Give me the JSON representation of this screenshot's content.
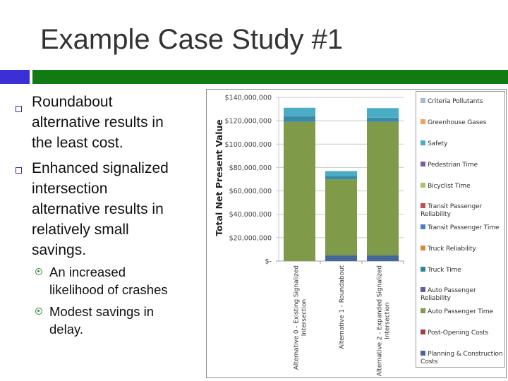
{
  "slide": {
    "title": "Example Case Study #1",
    "accent_colors": {
      "left_block": "#3b2fd6",
      "header_bar": "#127a12"
    },
    "bullets": [
      {
        "text_lines": [
          "Roundabout",
          "alternative results in",
          "the least cost."
        ]
      },
      {
        "text_lines": [
          "Enhanced signalized",
          "intersection",
          "alternative results in",
          "relatively small",
          "savings."
        ]
      }
    ],
    "sub_bullets": [
      {
        "text_lines": [
          "An increased",
          "likelihood of crashes"
        ]
      },
      {
        "text_lines": [
          "Modest savings in",
          "delay."
        ]
      }
    ]
  },
  "chart_data": {
    "type": "bar",
    "stacked": true,
    "title": "",
    "xlabel": "",
    "ylabel": "Total Net Present Value",
    "ylim": [
      0,
      140000000
    ],
    "yticks": [
      0,
      20000000,
      40000000,
      60000000,
      80000000,
      100000000,
      120000000,
      140000000
    ],
    "ytick_labels": [
      "$-",
      "$20,000,000",
      "$40,000,000",
      "$60,000,000",
      "$80,000,000",
      "$100,000,000",
      "$120,000,000",
      "$140,000,000"
    ],
    "grid": true,
    "legend_position": "right",
    "categories": [
      [
        "Alternative 0 - Existing Signalized",
        "Intersection"
      ],
      [
        "Alternative 1 - Roundabout"
      ],
      [
        "Alternative 2 - Expanded Signalized",
        "Intersection"
      ]
    ],
    "legend": [
      {
        "name": "Criteria Pollutants",
        "color": "#a6b8d8"
      },
      {
        "name": "Greenhouse Gases",
        "color": "#f0a060"
      },
      {
        "name": "Safety",
        "color": "#4bacc6"
      },
      {
        "name": "Pedestrian Time",
        "color": "#7a5fa0"
      },
      {
        "name": "Bicyclist Time",
        "color": "#a8c470"
      },
      {
        "name": "Transit Passenger Reliability",
        "color": "#c0504d"
      },
      {
        "name": "Transit Passenger Time",
        "color": "#4f81bd"
      },
      {
        "name": "Truck Reliability",
        "color": "#d98a40"
      },
      {
        "name": "Truck Time",
        "color": "#31859c"
      },
      {
        "name": "Auto Passenger Reliability",
        "color": "#6a5a9a"
      },
      {
        "name": "Auto Passenger Time",
        "color": "#7f9a48"
      },
      {
        "name": "Post-Opening Costs",
        "color": "#a0403e"
      },
      {
        "name": "Planning & Construction Costs",
        "color": "#44679a"
      }
    ],
    "series": [
      {
        "name": "Planning & Construction Costs",
        "color": "#44679a",
        "values": [
          0,
          4800000,
          4800000
        ]
      },
      {
        "name": "Post-Opening Costs",
        "color": "#a0403e",
        "values": [
          0,
          0,
          0
        ]
      },
      {
        "name": "Auto Passenger Time",
        "color": "#7f9a48",
        "values": [
          119000000,
          65000000,
          114200000
        ]
      },
      {
        "name": "Auto Passenger Reliability",
        "color": "#6a5a9a",
        "values": [
          0,
          0,
          0
        ]
      },
      {
        "name": "Truck Time",
        "color": "#3a8aa5",
        "values": [
          4800000,
          3000000,
          3600000
        ]
      },
      {
        "name": "Truck Reliability",
        "color": "#d98a40",
        "values": [
          0,
          0,
          0
        ]
      },
      {
        "name": "Transit Passenger Time",
        "color": "#4f81bd",
        "values": [
          0,
          0,
          0
        ]
      },
      {
        "name": "Transit Passenger Reliability",
        "color": "#c0504d",
        "values": [
          0,
          0,
          0
        ]
      },
      {
        "name": "Bicyclist Time",
        "color": "#a8c470",
        "values": [
          0,
          0,
          0
        ]
      },
      {
        "name": "Pedestrian Time",
        "color": "#7a5fa0",
        "values": [
          0,
          0,
          0
        ]
      },
      {
        "name": "Safety",
        "color": "#4bacc6",
        "values": [
          7300000,
          4200000,
          8200000
        ]
      },
      {
        "name": "Greenhouse Gases",
        "color": "#f0a060",
        "values": [
          0,
          0,
          0
        ]
      },
      {
        "name": "Criteria Pollutants",
        "color": "#a6b8d8",
        "values": [
          0,
          0,
          0
        ]
      }
    ]
  }
}
